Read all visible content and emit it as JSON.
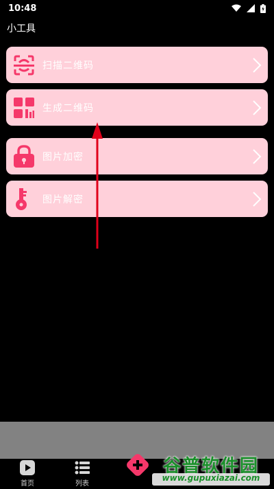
{
  "status_bar": {
    "time": "10:48"
  },
  "header": {
    "title": "小工具"
  },
  "tools": [
    {
      "label": "扫描二维码"
    },
    {
      "label": "生成二维码"
    },
    {
      "label": "图片加密"
    },
    {
      "label": "图片解密"
    }
  ],
  "bottom_nav": {
    "items": [
      {
        "label": "首页"
      },
      {
        "label": "列表"
      }
    ]
  },
  "watermark": {
    "main": "谷普软件园",
    "sub": "www.gupuxiazai.com"
  },
  "colors": {
    "card_bg": "#ffd0da",
    "icon_accent": "#f5386a",
    "annotation": "#e0001a",
    "gray_panel": "#828282"
  }
}
